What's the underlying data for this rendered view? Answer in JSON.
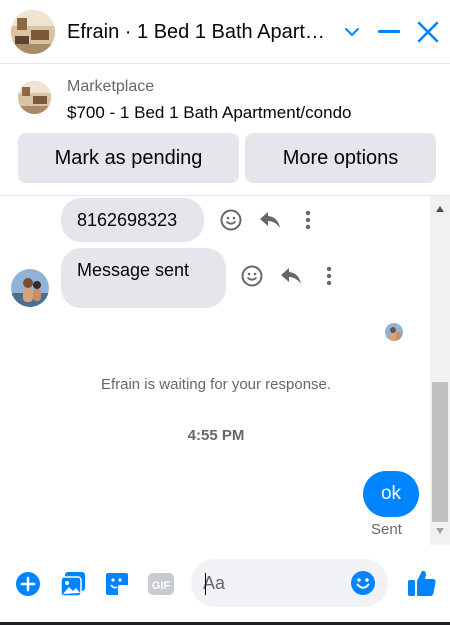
{
  "header": {
    "title": "Efrain · 1 Bed 1 Bath Apart…",
    "avatar_icon": "apartment-photo",
    "actions": [
      "chevron-down-icon",
      "minimize-icon",
      "close-icon"
    ]
  },
  "marketplace": {
    "label": "Marketplace",
    "listing": "$700 - 1 Bed 1 Bath Apartment/condo",
    "buttons": {
      "pending": "Mark as pending",
      "more": "More options"
    }
  },
  "messages": {
    "items": [
      {
        "text": "8162698323"
      },
      {
        "text": "Message sent"
      }
    ],
    "status": "Efrain is waiting for your response.",
    "timestamp": "4:55 PM",
    "outgoing": {
      "text": "ok",
      "status": "Sent"
    }
  },
  "composer": {
    "placeholder": "Aa",
    "icons": [
      "add-icon",
      "photo-icon",
      "sticker-icon",
      "gif-icon",
      "emoji-icon",
      "like-icon"
    ],
    "gif_label": "GIF"
  },
  "colors": {
    "accent": "#0084ff",
    "bubble_gray": "#e4e6eb",
    "secondary_text": "#65676b"
  }
}
